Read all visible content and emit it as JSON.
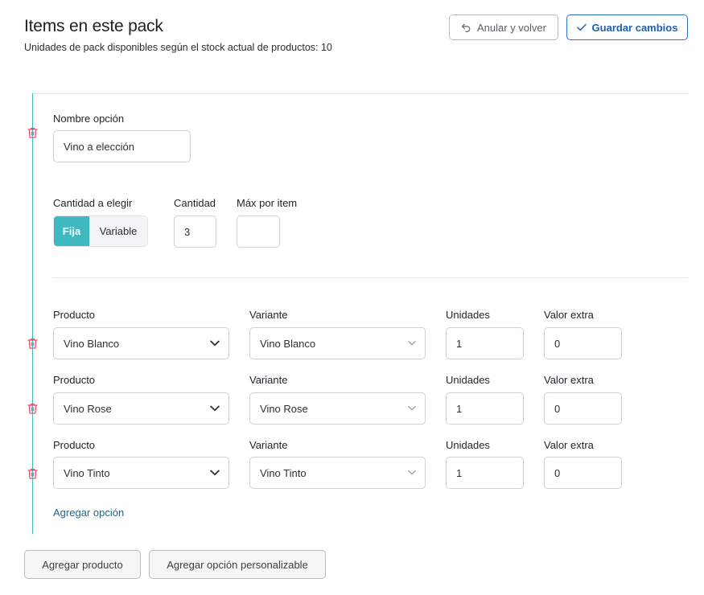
{
  "header": {
    "title": "Items en este pack",
    "subtitle": "Unidades de pack disponibles según el stock actual de productos: 10",
    "cancel_label": "Anular y volver",
    "save_label": "Guardar cambios"
  },
  "option": {
    "name_label": "Nombre opción",
    "name_value": "Vino a elección",
    "quantity_mode_label": "Cantidad a elegir",
    "mode_fixed": "Fija",
    "mode_variable": "Variable",
    "selected_mode": "Fija",
    "quantity_label": "Cantidad",
    "quantity_value": "3",
    "max_label": "Máx por item",
    "max_value": ""
  },
  "items": [
    {
      "product_label": "Producto",
      "product": "Vino Blanco",
      "variant_label": "Variante",
      "variant": "Vino Blanco",
      "units_label": "Unidades",
      "units": "1",
      "extra_label": "Valor extra",
      "extra": "0"
    },
    {
      "product_label": "Producto",
      "product": "Vino Rose",
      "variant_label": "Variante",
      "variant": "Vino Rose",
      "units_label": "Unidades",
      "units": "1",
      "extra_label": "Valor extra",
      "extra": "0"
    },
    {
      "product_label": "Producto",
      "product": "Vino Tinto",
      "variant_label": "Variante",
      "variant": "Vino Tinto",
      "units_label": "Unidades",
      "units": "1",
      "extra_label": "Valor extra",
      "extra": "0"
    }
  ],
  "actions": {
    "add_option": "Agregar opción",
    "add_product": "Agregar producto",
    "add_custom_option": "Agregar opción personalizable"
  },
  "icons": {
    "cancel": "undo-arrow-icon",
    "save": "check-icon",
    "delete": "trash-icon",
    "dropdown": "chevron-down-icon"
  },
  "colors": {
    "accent": "#3fb8bf",
    "primary": "#2a73c9",
    "danger": "#e0506a",
    "link": "#1b6a8f"
  }
}
